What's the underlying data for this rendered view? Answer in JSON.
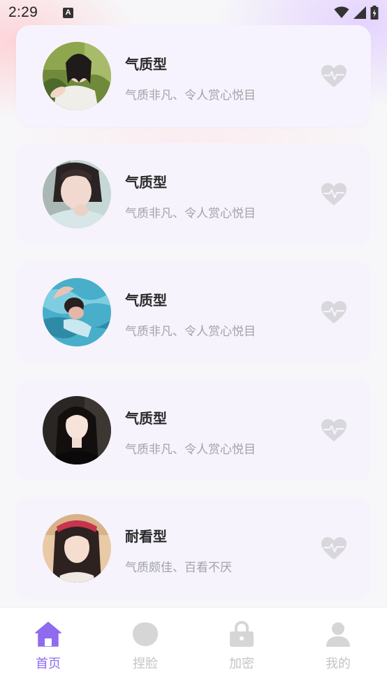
{
  "status_bar": {
    "time": "2:29",
    "notification_icon": "a-letter-icon",
    "icons": [
      "wifi-icon",
      "signal-icon",
      "battery-charging-icon"
    ]
  },
  "cards": [
    {
      "title": "气质型",
      "subtitle": "气质非凡、令人赏心悦目",
      "avatar": "avatar-1",
      "icon": "heartbeat-icon"
    },
    {
      "title": "气质型",
      "subtitle": "气质非凡、令人赏心悦目",
      "avatar": "avatar-2",
      "icon": "heartbeat-icon"
    },
    {
      "title": "气质型",
      "subtitle": "气质非凡、令人赏心悦目",
      "avatar": "avatar-3",
      "icon": "heartbeat-icon"
    },
    {
      "title": "气质型",
      "subtitle": "气质非凡、令人赏心悦目",
      "avatar": "avatar-4",
      "icon": "heartbeat-icon"
    },
    {
      "title": "耐看型",
      "subtitle": "气质颇佳、百看不厌",
      "avatar": "avatar-5",
      "icon": "heartbeat-icon"
    }
  ],
  "tabs": [
    {
      "label": "首页",
      "icon": "home-icon",
      "active": true
    },
    {
      "label": "捏脸",
      "icon": "face-icon",
      "active": false
    },
    {
      "label": "加密",
      "icon": "lock-icon",
      "active": false
    },
    {
      "label": "我的",
      "icon": "person-icon",
      "active": false
    }
  ],
  "colors": {
    "accent": "#8f6bf0",
    "card_bg": "#f6f3fd",
    "title": "#2a2a2a",
    "subtitle": "#a3a3a8",
    "inactive": "#c4c4c4"
  }
}
